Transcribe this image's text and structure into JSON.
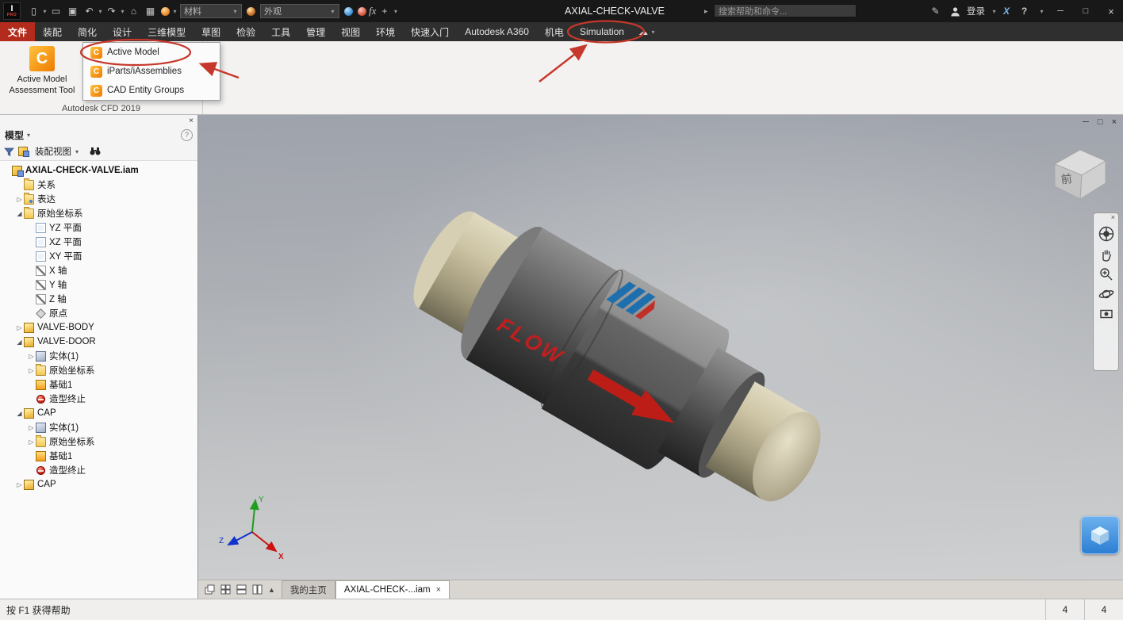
{
  "colors": {
    "annotation_red": "#c6382b",
    "file_tab_red": "#b32b1d",
    "flow_red": "#c01f1f",
    "cfd_orange": "#ef7a00",
    "assist_blue": "#2d7fd3"
  },
  "titlebar": {
    "title": "AXIAL-CHECK-VALVE",
    "breadcrumb_arrow": "▸",
    "search_placeholder": "搜索帮助和命令...",
    "signin_label": "登录",
    "help_glyph": "?",
    "material_value": "材料",
    "appearance_value": "外观",
    "qat": [
      {
        "name": "new-file-icon",
        "glyph": "▯"
      },
      {
        "name": "new-file-caret-icon",
        "glyph": "▾"
      },
      {
        "name": "open-icon",
        "glyph": "▭"
      },
      {
        "name": "save-icon",
        "glyph": "▣"
      },
      {
        "name": "undo-icon",
        "glyph": "↶"
      },
      {
        "name": "undo-caret-icon",
        "glyph": "▾"
      },
      {
        "name": "redo-icon",
        "glyph": "↷"
      },
      {
        "name": "redo-caret-icon",
        "glyph": "▾"
      },
      {
        "name": "home-icon",
        "glyph": "⌂"
      },
      {
        "name": "render-icon",
        "glyph": "▦"
      },
      {
        "name": "material-ball-icon",
        "ball": "orange"
      },
      {
        "name": "material-caret-icon",
        "glyph": "▾"
      }
    ],
    "post_icons": [
      {
        "name": "appearance-adjust-icon",
        "ball": "blue"
      },
      {
        "name": "appearance-search-icon",
        "ball": "red"
      },
      {
        "name": "parameters-fx-icon",
        "glyph": "fx",
        "style": "fx"
      },
      {
        "name": "measure-plus-icon",
        "glyph": "+"
      },
      {
        "name": "qat-caret-icon",
        "glyph": "▾"
      }
    ],
    "window": {
      "min": "─",
      "max": "□",
      "close": "×",
      "a360_x": "X"
    }
  },
  "ribbon": {
    "tabs": [
      {
        "id": "file",
        "label": "文件",
        "accent": true
      },
      {
        "id": "assemble",
        "label": "装配"
      },
      {
        "id": "simplify",
        "label": "简化"
      },
      {
        "id": "design",
        "label": "设计"
      },
      {
        "id": "model-3d",
        "label": "三维模型"
      },
      {
        "id": "sketch",
        "label": "草图"
      },
      {
        "id": "inspect",
        "label": "检验"
      },
      {
        "id": "tools",
        "label": "工具"
      },
      {
        "id": "manage",
        "label": "管理"
      },
      {
        "id": "view",
        "label": "视图"
      },
      {
        "id": "environments",
        "label": "环境"
      },
      {
        "id": "get-started",
        "label": "快速入门"
      },
      {
        "id": "a360",
        "label": "Autodesk A360"
      },
      {
        "id": "electromechanical",
        "label": "机电"
      },
      {
        "id": "simulation",
        "label": "Simulation"
      }
    ],
    "panel": {
      "big_button_line1": "Active Model",
      "big_button_line2": "Assessment Tool",
      "group_label": "Autodesk CFD 2019",
      "menu_items": [
        {
          "label": "Active Model"
        },
        {
          "label": "iParts/iAssemblies"
        },
        {
          "label": "CAD Entity Groups"
        }
      ]
    }
  },
  "browser": {
    "header": "模型",
    "view_selector": "装配视图",
    "tree": [
      {
        "name": "root-assembly",
        "label": "AXIAL-CHECK-VALVE.iam",
        "depth": 0,
        "icon": "assembly",
        "exp": "none",
        "bold": true
      },
      {
        "name": "relationships-folder",
        "label": "关系",
        "depth": 1,
        "icon": "folder",
        "exp": "none"
      },
      {
        "name": "representations-folder",
        "label": "表达",
        "depth": 1,
        "icon": "folder-view",
        "exp": "closed"
      },
      {
        "name": "origin-folder",
        "label": "原始坐标系",
        "depth": 1,
        "icon": "folder-origin",
        "exp": "open"
      },
      {
        "name": "yz-plane",
        "label": "YZ 平面",
        "depth": 2,
        "icon": "plane",
        "exp": "none"
      },
      {
        "name": "xz-plane",
        "label": "XZ 平面",
        "depth": 2,
        "icon": "plane",
        "exp": "none"
      },
      {
        "name": "xy-plane",
        "label": "XY 平面",
        "depth": 2,
        "icon": "plane",
        "exp": "none"
      },
      {
        "name": "x-axis",
        "label": "X 轴",
        "depth": 2,
        "icon": "axis",
        "exp": "none"
      },
      {
        "name": "y-axis",
        "label": "Y 轴",
        "depth": 2,
        "icon": "axis",
        "exp": "none"
      },
      {
        "name": "z-axis",
        "label": "Z 轴",
        "depth": 2,
        "icon": "axis",
        "exp": "none"
      },
      {
        "name": "origin-point",
        "label": "原点",
        "depth": 2,
        "icon": "origin",
        "exp": "none"
      },
      {
        "name": "valve-body",
        "label": "VALVE-BODY",
        "depth": 1,
        "icon": "part",
        "exp": "closed"
      },
      {
        "name": "valve-door",
        "label": "VALVE-DOOR",
        "depth": 1,
        "icon": "part",
        "exp": "open"
      },
      {
        "name": "valve-door-solid",
        "label": "实体(1)",
        "depth": 2,
        "icon": "solid",
        "exp": "closed"
      },
      {
        "name": "valve-door-origin",
        "label": "原始坐标系",
        "depth": 2,
        "icon": "folder-origin",
        "exp": "closed"
      },
      {
        "name": "valve-door-base-feature",
        "label": "基础1",
        "depth": 2,
        "icon": "feature",
        "exp": "none"
      },
      {
        "name": "valve-door-end-of-part",
        "label": "造型终止",
        "depth": 2,
        "icon": "eop",
        "exp": "none"
      },
      {
        "name": "cap-1",
        "label": "CAP",
        "depth": 1,
        "icon": "part",
        "exp": "open"
      },
      {
        "name": "cap-1-solid",
        "label": "实体(1)",
        "depth": 2,
        "icon": "solid",
        "exp": "closed"
      },
      {
        "name": "cap-1-origin",
        "label": "原始坐标系",
        "depth": 2,
        "icon": "folder-origin",
        "exp": "closed"
      },
      {
        "name": "cap-1-base-feature",
        "label": "基础1",
        "depth": 2,
        "icon": "feature",
        "exp": "none"
      },
      {
        "name": "cap-1-end-of-part",
        "label": "造型终止",
        "depth": 2,
        "icon": "eop",
        "exp": "none"
      },
      {
        "name": "cap-2",
        "label": "CAP",
        "depth": 1,
        "icon": "part",
        "exp": "closed"
      }
    ]
  },
  "viewport": {
    "viewcube_face": "前",
    "flow_label": "FLOW",
    "axes": {
      "x": "X",
      "y": "Y",
      "z": "Z"
    }
  },
  "docbar": {
    "tabs": [
      {
        "label": "我的主页",
        "active": false,
        "closable": false
      },
      {
        "label": "AXIAL-CHECK-...iam",
        "active": true,
        "closable": true
      }
    ]
  },
  "statusbar": {
    "help_text": "按 F1 获得帮助",
    "cells": [
      "4",
      "4"
    ]
  }
}
